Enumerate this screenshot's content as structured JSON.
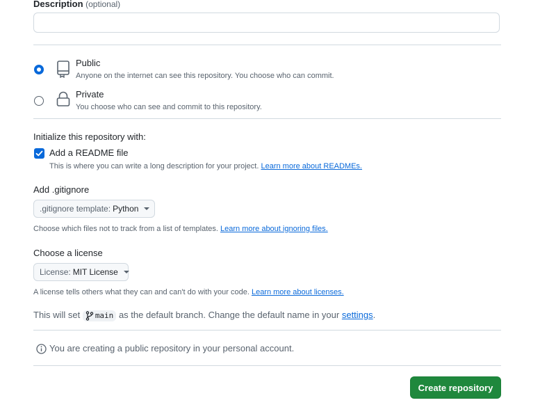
{
  "description": {
    "label": "Description",
    "optional": "(optional)",
    "value": ""
  },
  "visibility": {
    "options": [
      {
        "title": "Public",
        "desc": "Anyone on the internet can see this repository. You choose who can commit.",
        "checked": true
      },
      {
        "title": "Private",
        "desc": "You choose who can see and commit to this repository.",
        "checked": false
      }
    ]
  },
  "init": {
    "heading": "Initialize this repository with:",
    "readme_label": "Add a README file",
    "readme_checked": true,
    "readme_desc": "This is where you can write a long description for your project.",
    "readme_link": "Learn more about READMEs."
  },
  "gitignore": {
    "heading": "Add .gitignore",
    "prefix": ".gitignore template:",
    "value": "Python",
    "desc": "Choose which files not to track from a list of templates.",
    "link": "Learn more about ignoring files."
  },
  "license": {
    "heading": "Choose a license",
    "prefix": "License:",
    "value": "MIT License",
    "desc": "A license tells others what they can and can't do with your code.",
    "link": "Learn more about licenses."
  },
  "branch": {
    "pre": "This will set",
    "name": "main",
    "post": "as the default branch. Change the default name in your",
    "link": "settings",
    "end": "."
  },
  "notice": {
    "text": "You are creating a public repository in your personal account."
  },
  "actions": {
    "create_label": "Create repository"
  },
  "colors": {
    "accent": "#0969da",
    "primary_button": "#1f883d",
    "border": "#d1d9e0"
  }
}
